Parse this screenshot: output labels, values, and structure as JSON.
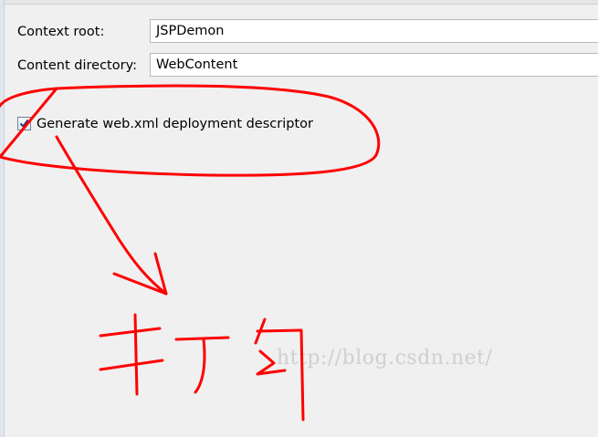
{
  "form": {
    "context_root": {
      "label": "Context root:",
      "value": "JSPDemon"
    },
    "content_directory": {
      "label": "Content directory:",
      "value": "WebContent"
    },
    "generate_web_xml": {
      "label": "Generate web.xml deployment descriptor",
      "checked": true
    }
  },
  "watermark": "http://blog.csdn.net/",
  "annotation": {
    "color": "#ff0000"
  }
}
